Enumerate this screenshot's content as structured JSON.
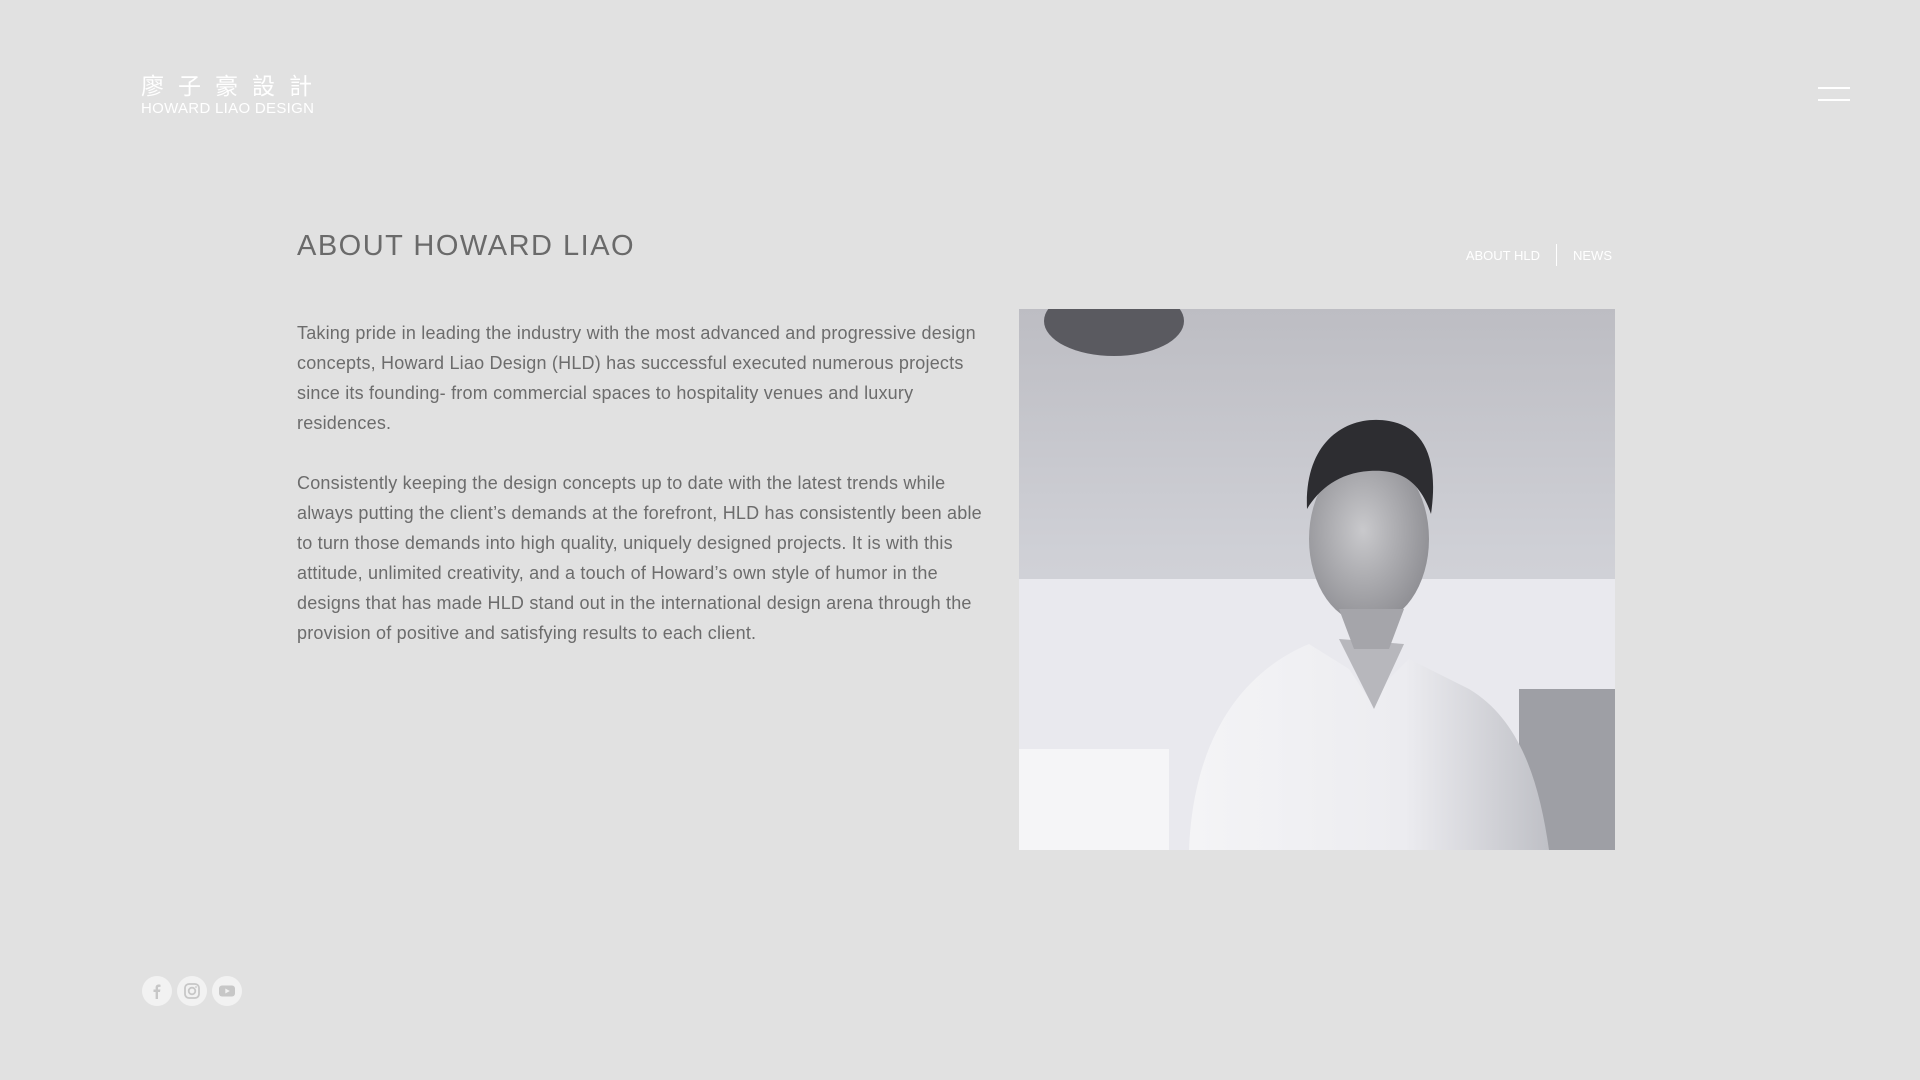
{
  "logo": {
    "chinese": "廖子豪設計",
    "english": "HOWARD LIAO DESIGN"
  },
  "header": {
    "menu_icon": "hamburger-menu-icon"
  },
  "page": {
    "title": "ABOUT HOWARD LIAO"
  },
  "subnav": {
    "items": [
      {
        "label": "ABOUT HLD"
      },
      {
        "label": "NEWS"
      }
    ]
  },
  "content": {
    "paragraphs": [
      "Taking pride in leading the industry with the most advanced and progressive design concepts, Howard Liao Design (HLD) has successful executed numerous projects since its founding- from commercial spaces to hospitality venues and luxury residences.",
      "Consistently keeping the design concepts up to date with the latest trends while always putting the client’s demands at the forefront, HLD has consistently been able to turn those demands into high quality, uniquely designed projects. It is with this attitude, unlimited creativity, and a touch of Howard’s own style of humor in the designs that has made HLD stand out in the international design arena through the provision of positive and satisfying results to each client."
    ]
  },
  "social": {
    "icons": [
      "facebook-icon",
      "instagram-icon",
      "youtube-icon"
    ]
  },
  "colors": {
    "background": "#e1e1e1",
    "text": "#6c6c6c",
    "white": "#ffffff"
  }
}
